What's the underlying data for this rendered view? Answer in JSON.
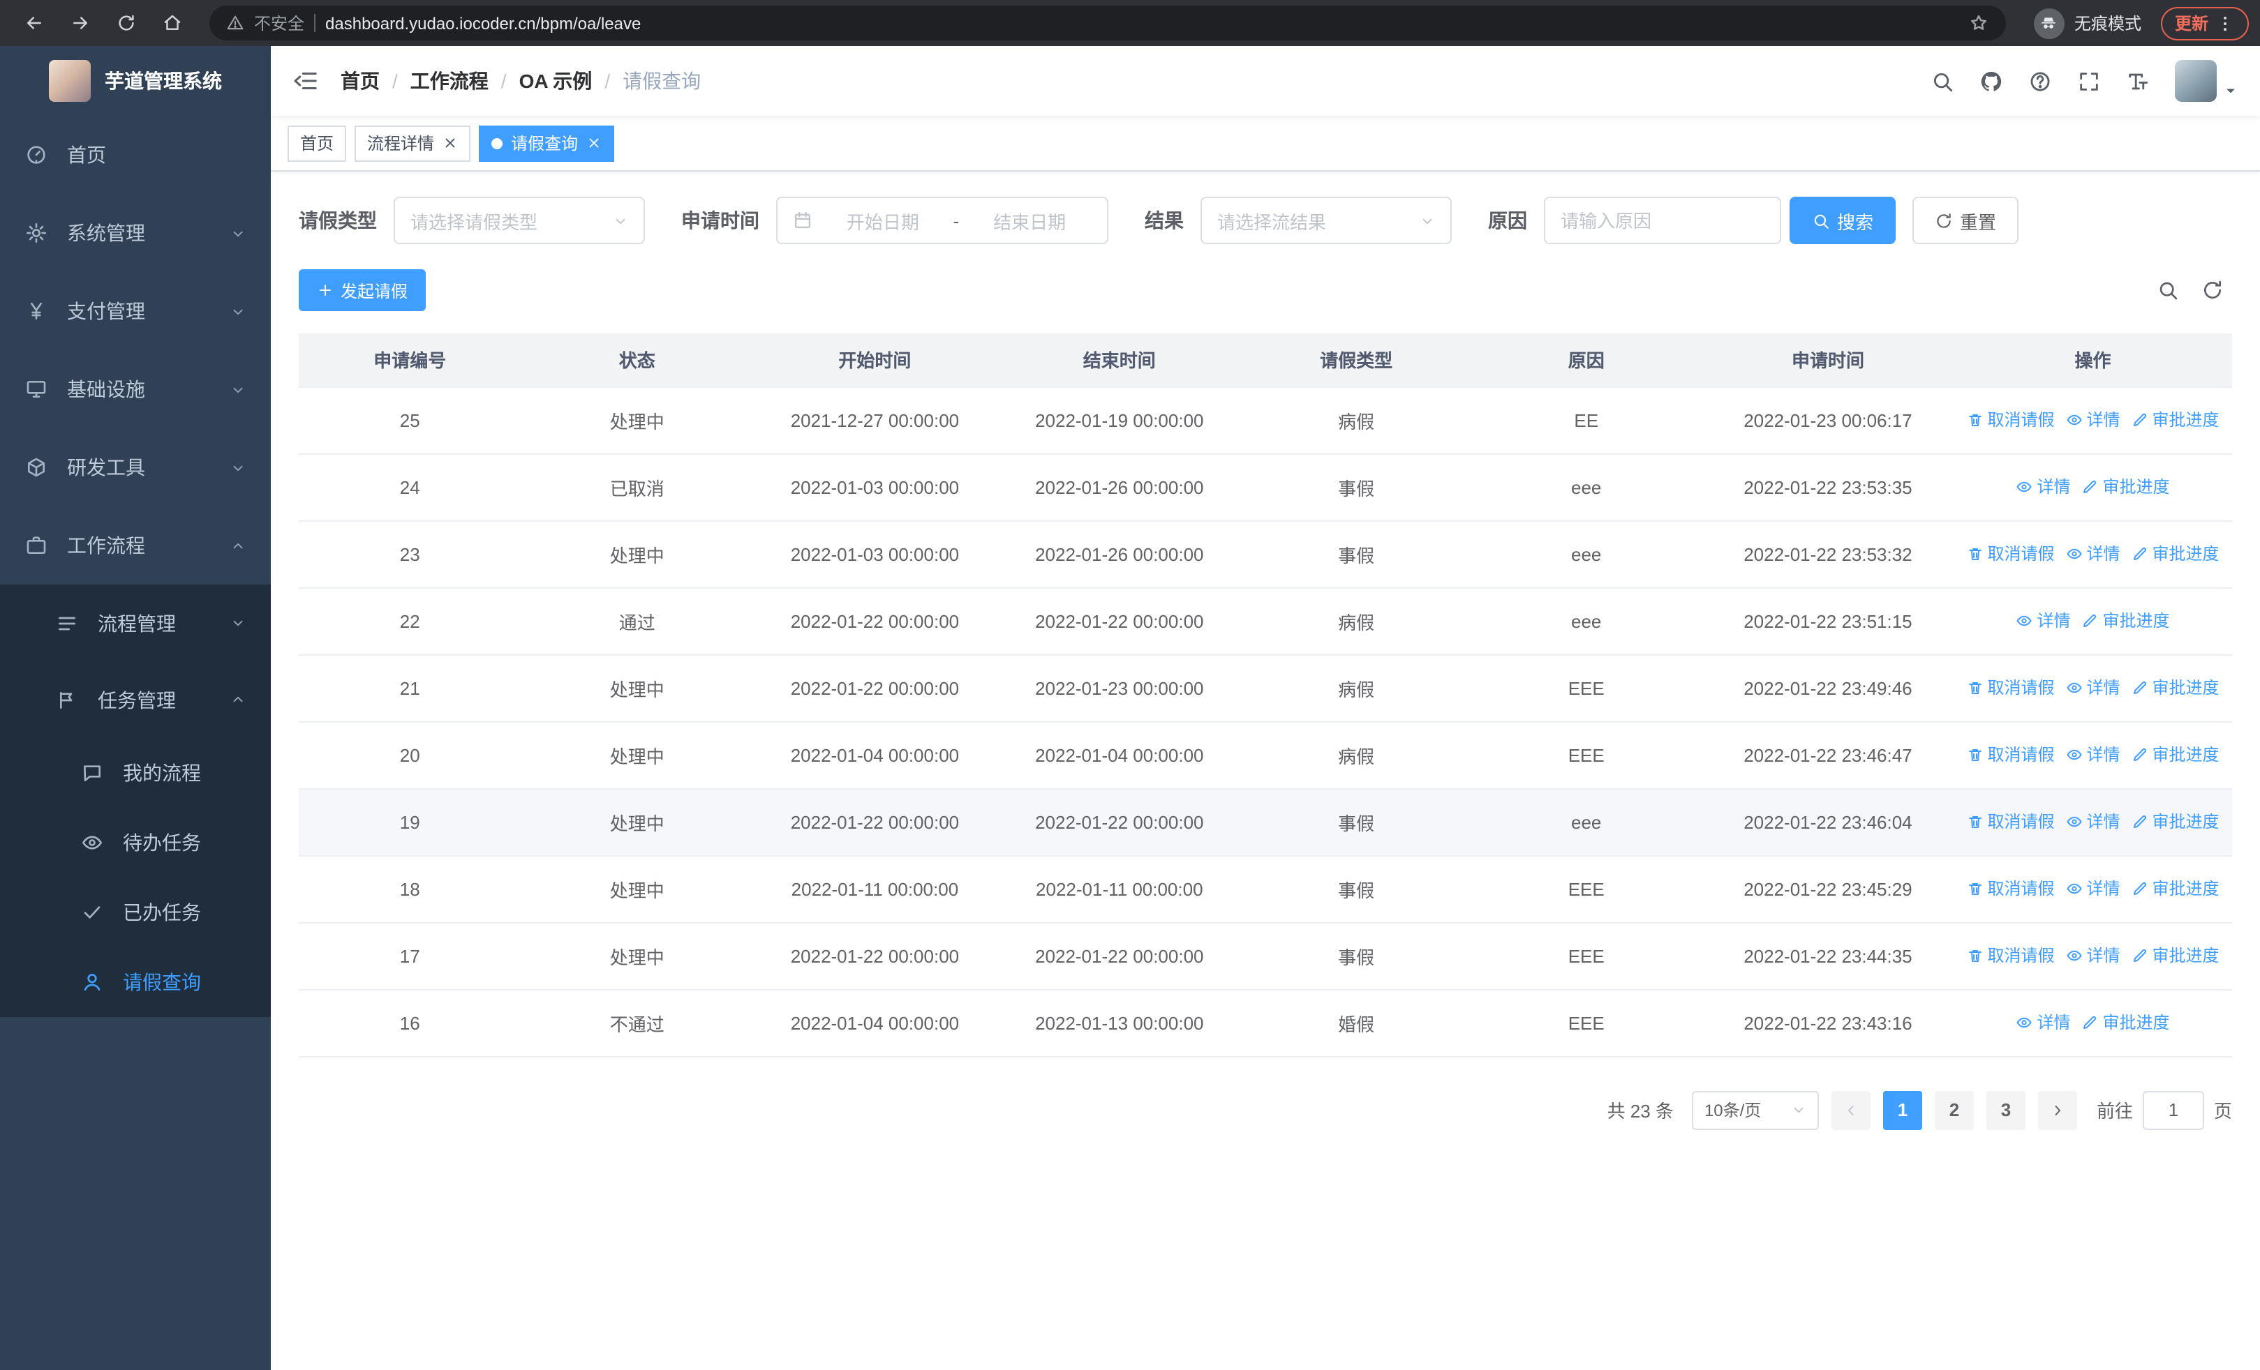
{
  "browser": {
    "nav_icons": [
      "back-icon",
      "forward-icon",
      "reload-icon",
      "home-icon"
    ],
    "security_label": "不安全",
    "url": "dashboard.yudao.iocoder.cn/bpm/oa/leave",
    "incognito_label": "无痕模式",
    "update_label": "更新"
  },
  "sidebar": {
    "logo_title": "芋道管理系统",
    "items": [
      {
        "label": "首页",
        "icon": "dashboard-icon",
        "level": 1,
        "arrow": "none",
        "active": false
      },
      {
        "label": "系统管理",
        "icon": "gear-icon",
        "level": 1,
        "arrow": "down",
        "active": false
      },
      {
        "label": "支付管理",
        "icon": "yen-icon",
        "level": 1,
        "arrow": "down",
        "active": false
      },
      {
        "label": "基础设施",
        "icon": "infrastructure-icon",
        "level": 1,
        "arrow": "down",
        "active": false
      },
      {
        "label": "研发工具",
        "icon": "tools-icon",
        "level": 1,
        "arrow": "down",
        "active": false
      },
      {
        "label": "工作流程",
        "icon": "workflow-icon",
        "level": 1,
        "arrow": "up",
        "active": false
      },
      {
        "label": "流程管理",
        "icon": "process-icon",
        "level": 2,
        "arrow": "down",
        "active": false
      },
      {
        "label": "任务管理",
        "icon": "task-icon",
        "level": 2,
        "arrow": "up",
        "active": false
      },
      {
        "label": "我的流程",
        "icon": "chat-icon",
        "level": 3,
        "arrow": "none",
        "active": false
      },
      {
        "label": "待办任务",
        "icon": "eye-icon",
        "level": 3,
        "arrow": "none",
        "active": false
      },
      {
        "label": "已办任务",
        "icon": "check-icon",
        "level": 3,
        "arrow": "none",
        "active": false
      },
      {
        "label": "请假查询",
        "icon": "user-icon",
        "level": 3,
        "arrow": "none",
        "active": true
      }
    ]
  },
  "navbar": {
    "tool_icons": [
      "search-icon",
      "github-icon",
      "question-icon",
      "fullscreen-icon",
      "font-size-icon"
    ]
  },
  "breadcrumb": {
    "items": [
      "首页",
      "工作流程",
      "OA 示例",
      "请假查询"
    ]
  },
  "tabs": [
    {
      "label": "首页",
      "closable": false,
      "active": false
    },
    {
      "label": "流程详情",
      "closable": true,
      "active": false
    },
    {
      "label": "请假查询",
      "closable": true,
      "active": true
    }
  ],
  "filters": {
    "leave_type_label": "请假类型",
    "leave_type_placeholder": "请选择请假类型",
    "apply_time_label": "申请时间",
    "start_date_placeholder": "开始日期",
    "range_separator": "-",
    "end_date_placeholder": "结束日期",
    "result_label": "结果",
    "result_placeholder": "请选择流结果",
    "reason_label": "原因",
    "reason_placeholder": "请输入原因",
    "search_button": "搜索",
    "reset_button": "重置"
  },
  "toolbar": {
    "create_button": "发起请假"
  },
  "table": {
    "columns": [
      "申请编号",
      "状态",
      "开始时间",
      "结束时间",
      "请假类型",
      "原因",
      "申请时间",
      "操作"
    ],
    "action_labels": {
      "cancel": "取消请假",
      "detail": "详情",
      "progress": "审批进度"
    },
    "action_icons": {
      "cancel": "trash-icon",
      "detail": "eye-icon",
      "progress": "edit-icon"
    },
    "rows": [
      {
        "id": "25",
        "status": "处理中",
        "start": "2021-12-27 00:00:00",
        "end": "2022-01-19 00:00:00",
        "type": "病假",
        "reason": "EE",
        "applied": "2022-01-23 00:06:17",
        "actions": [
          "cancel",
          "detail",
          "progress"
        ],
        "highlighted": false
      },
      {
        "id": "24",
        "status": "已取消",
        "start": "2022-01-03 00:00:00",
        "end": "2022-01-26 00:00:00",
        "type": "事假",
        "reason": "eee",
        "applied": "2022-01-22 23:53:35",
        "actions": [
          "detail",
          "progress"
        ],
        "highlighted": false
      },
      {
        "id": "23",
        "status": "处理中",
        "start": "2022-01-03 00:00:00",
        "end": "2022-01-26 00:00:00",
        "type": "事假",
        "reason": "eee",
        "applied": "2022-01-22 23:53:32",
        "actions": [
          "cancel",
          "detail",
          "progress"
        ],
        "highlighted": false
      },
      {
        "id": "22",
        "status": "通过",
        "start": "2022-01-22 00:00:00",
        "end": "2022-01-22 00:00:00",
        "type": "病假",
        "reason": "eee",
        "applied": "2022-01-22 23:51:15",
        "actions": [
          "detail",
          "progress"
        ],
        "highlighted": false
      },
      {
        "id": "21",
        "status": "处理中",
        "start": "2022-01-22 00:00:00",
        "end": "2022-01-23 00:00:00",
        "type": "病假",
        "reason": "EEE",
        "applied": "2022-01-22 23:49:46",
        "actions": [
          "cancel",
          "detail",
          "progress"
        ],
        "highlighted": false
      },
      {
        "id": "20",
        "status": "处理中",
        "start": "2022-01-04 00:00:00",
        "end": "2022-01-04 00:00:00",
        "type": "病假",
        "reason": "EEE",
        "applied": "2022-01-22 23:46:47",
        "actions": [
          "cancel",
          "detail",
          "progress"
        ],
        "highlighted": false
      },
      {
        "id": "19",
        "status": "处理中",
        "start": "2022-01-22 00:00:00",
        "end": "2022-01-22 00:00:00",
        "type": "事假",
        "reason": "eee",
        "applied": "2022-01-22 23:46:04",
        "actions": [
          "cancel",
          "detail",
          "progress"
        ],
        "highlighted": true
      },
      {
        "id": "18",
        "status": "处理中",
        "start": "2022-01-11 00:00:00",
        "end": "2022-01-11 00:00:00",
        "type": "事假",
        "reason": "EEE",
        "applied": "2022-01-22 23:45:29",
        "actions": [
          "cancel",
          "detail",
          "progress"
        ],
        "highlighted": false
      },
      {
        "id": "17",
        "status": "处理中",
        "start": "2022-01-22 00:00:00",
        "end": "2022-01-22 00:00:00",
        "type": "事假",
        "reason": "EEE",
        "applied": "2022-01-22 23:44:35",
        "actions": [
          "cancel",
          "detail",
          "progress"
        ],
        "highlighted": false
      },
      {
        "id": "16",
        "status": "不通过",
        "start": "2022-01-04 00:00:00",
        "end": "2022-01-13 00:00:00",
        "type": "婚假",
        "reason": "EEE",
        "applied": "2022-01-22 23:43:16",
        "actions": [
          "detail",
          "progress"
        ],
        "highlighted": false
      }
    ]
  },
  "pagination": {
    "total_label": "共 23 条",
    "page_size": "10条/页",
    "pages": [
      "1",
      "2",
      "3"
    ],
    "active_page": "1",
    "goto_label": "前往",
    "goto_value": "1",
    "page_unit": "页"
  },
  "colors": {
    "primary": "#409eff",
    "sidebar_background": "#304156",
    "submenu_background": "#1f2d3d",
    "table_header_background": "#f2f3f5",
    "highlight_row_background": "#f5f7fa",
    "update_badge_color": "#e5604f"
  }
}
